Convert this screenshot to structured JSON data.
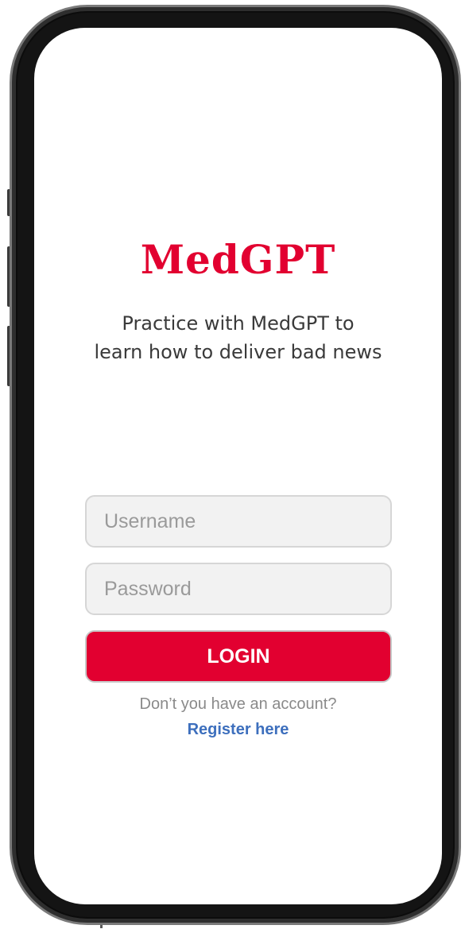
{
  "app": {
    "logo_text": "MedGPT",
    "tagline_line1": "Practice with MedGPT to",
    "tagline_line2": "learn how to deliver bad news"
  },
  "login_form": {
    "username_placeholder": "Username",
    "username_value": "",
    "password_placeholder": "Password",
    "password_value": "",
    "login_label": "LOGIN"
  },
  "register": {
    "prompt": "Don’t you have an account?",
    "link_label": "Register here"
  },
  "colors": {
    "brand": "#e20030",
    "link": "#3d6fbd",
    "field_background": "#f2f2f2",
    "tagline_text": "#3a3a3a"
  }
}
